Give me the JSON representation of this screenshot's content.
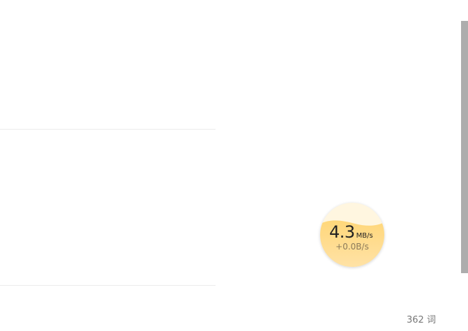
{
  "speed_widget": {
    "speed_value": "4.3",
    "speed_unit": "MB/s",
    "upload_text": "+0.0B/s"
  },
  "status_bar": {
    "word_count": "362 词"
  }
}
